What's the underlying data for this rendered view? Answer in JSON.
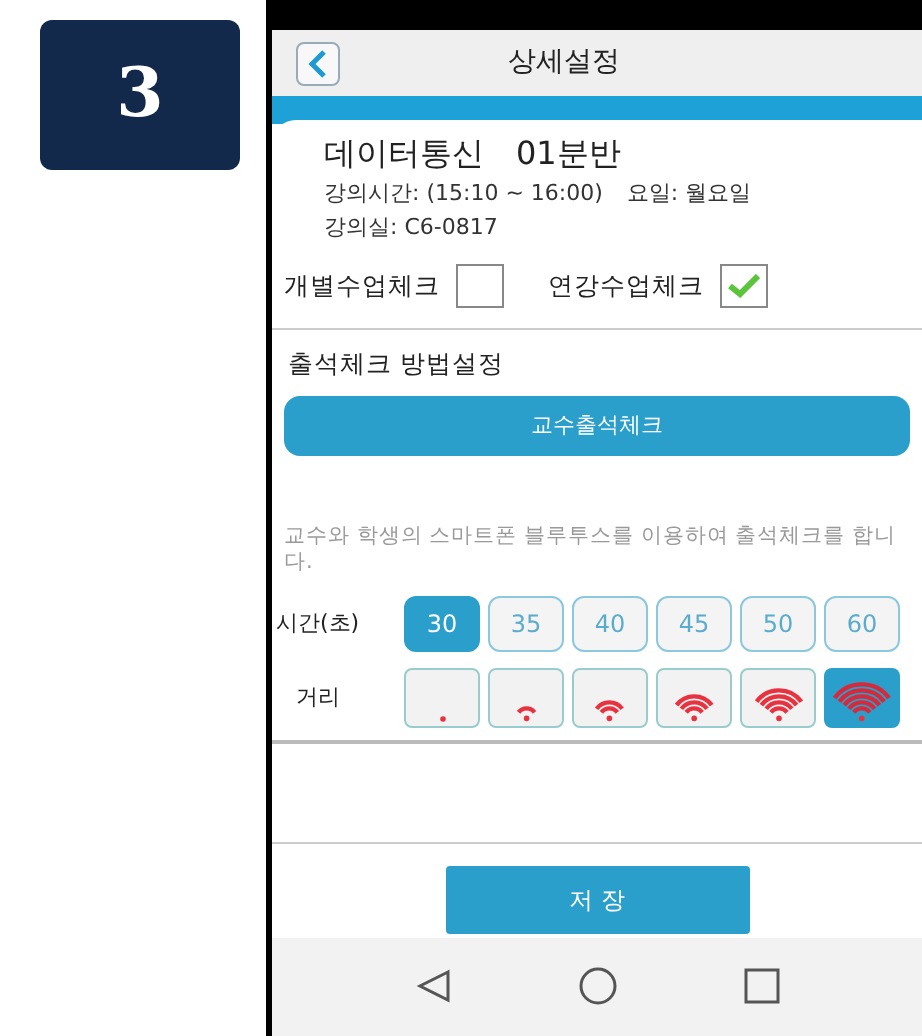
{
  "step_badge": "3",
  "header": {
    "title": "상세설정"
  },
  "course": {
    "name": "데이터통신",
    "section": "01분반",
    "time": "강의시간: (15:10 ~ 16:00)",
    "day": "요일: 월요일",
    "room": "강의실: C6-0817"
  },
  "checks": [
    {
      "label": "개별수업체크",
      "checked": false
    },
    {
      "label": "연강수업체크",
      "checked": true
    }
  ],
  "method": {
    "heading": "출석체크 방법설정",
    "button": "교수출석체크",
    "description": "교수와 학생의 스마트폰 블루투스를 이용하여 출석체크를 합니다."
  },
  "time": {
    "label": "시간(초)",
    "options": [
      {
        "label": "30",
        "selected": true
      },
      {
        "label": "35",
        "selected": false
      },
      {
        "label": "40",
        "selected": false
      },
      {
        "label": "45",
        "selected": false
      },
      {
        "label": "50",
        "selected": false
      },
      {
        "label": "60",
        "selected": false
      }
    ]
  },
  "distance": {
    "label": "거리",
    "options": [
      {
        "selected": false
      },
      {
        "selected": false
      },
      {
        "selected": false
      },
      {
        "selected": false
      },
      {
        "selected": false
      },
      {
        "selected": true
      }
    ]
  },
  "save_button": "저 장"
}
